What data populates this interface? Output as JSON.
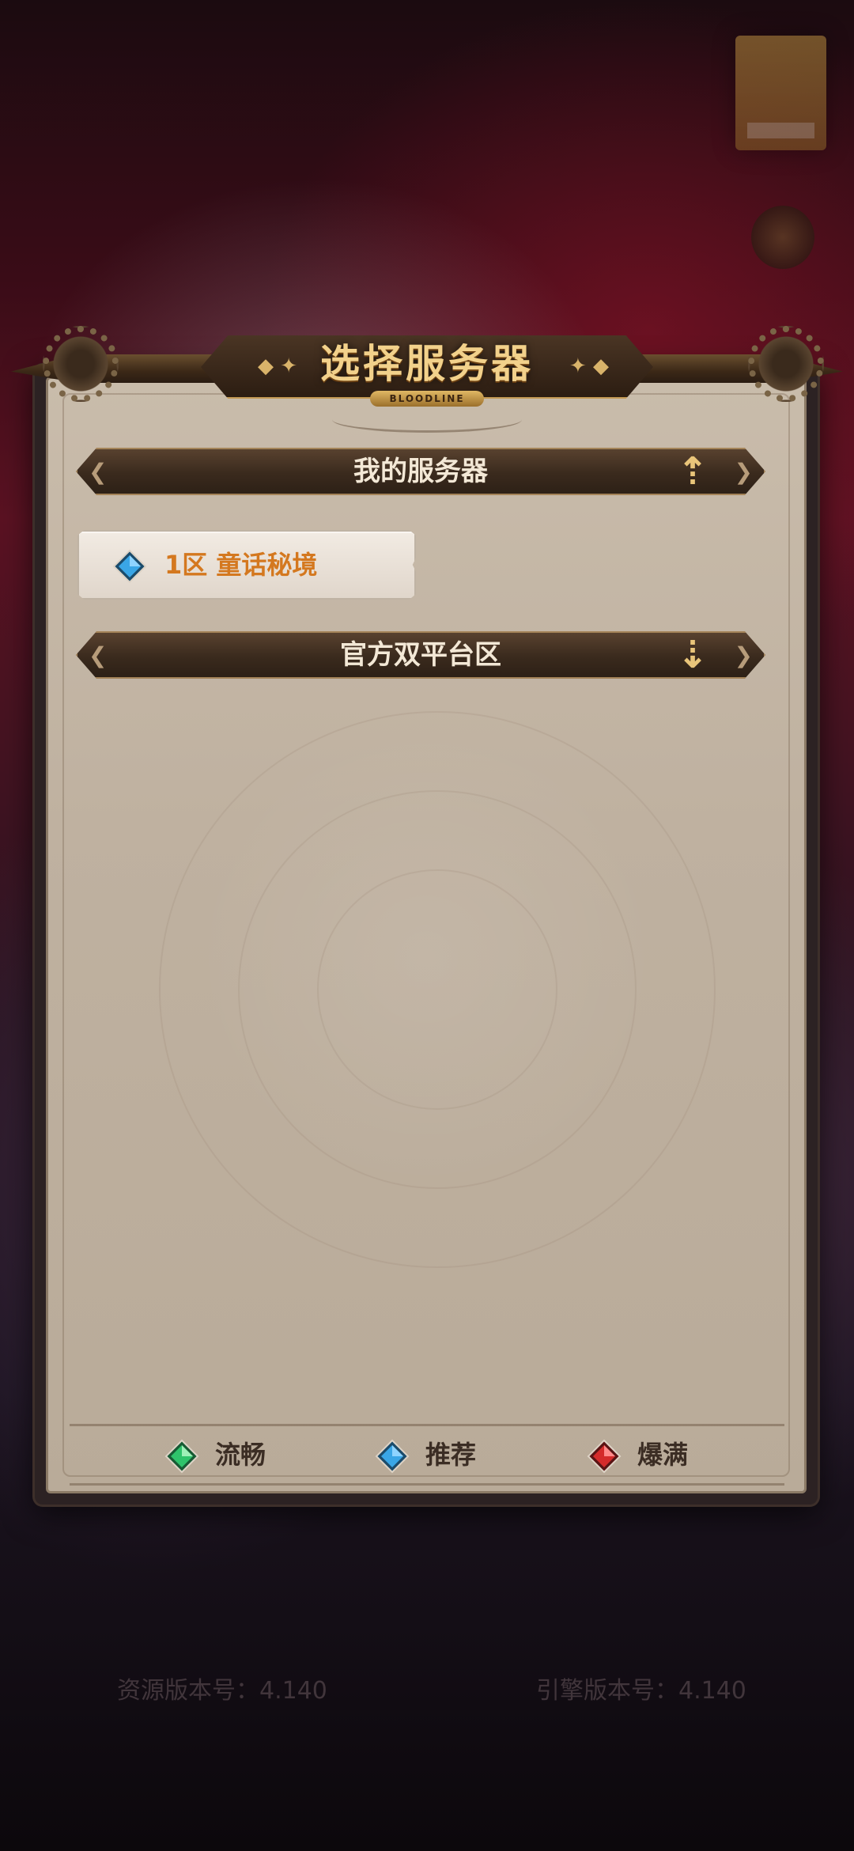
{
  "dialog": {
    "title": "选择服务器",
    "subtitle_badge": "BLOODLINE"
  },
  "sections": [
    {
      "label": "我的服务器",
      "state": "expanded",
      "arrow_icon": "arrow-up-icon"
    },
    {
      "label": "官方双平台区",
      "state": "collapsed",
      "arrow_icon": "arrow-down-icon"
    }
  ],
  "my_servers": [
    {
      "name": "1区 童话秘境",
      "status": "recommended",
      "gem_color": "#3aa6e6"
    }
  ],
  "legend": [
    {
      "label": "流畅",
      "gem_color": "#2fc36b"
    },
    {
      "label": "推荐",
      "gem_color": "#3aa6e6"
    },
    {
      "label": "爆满",
      "gem_color": "#d42b2b"
    }
  ],
  "footer": {
    "resource_version": "资源版本号：4.140",
    "engine_version": "引擎版本号：4.140"
  },
  "colors": {
    "title_gold": "#f2d18b",
    "server_name": "#d4781f",
    "panel_parchment": "#c3b5a3"
  }
}
